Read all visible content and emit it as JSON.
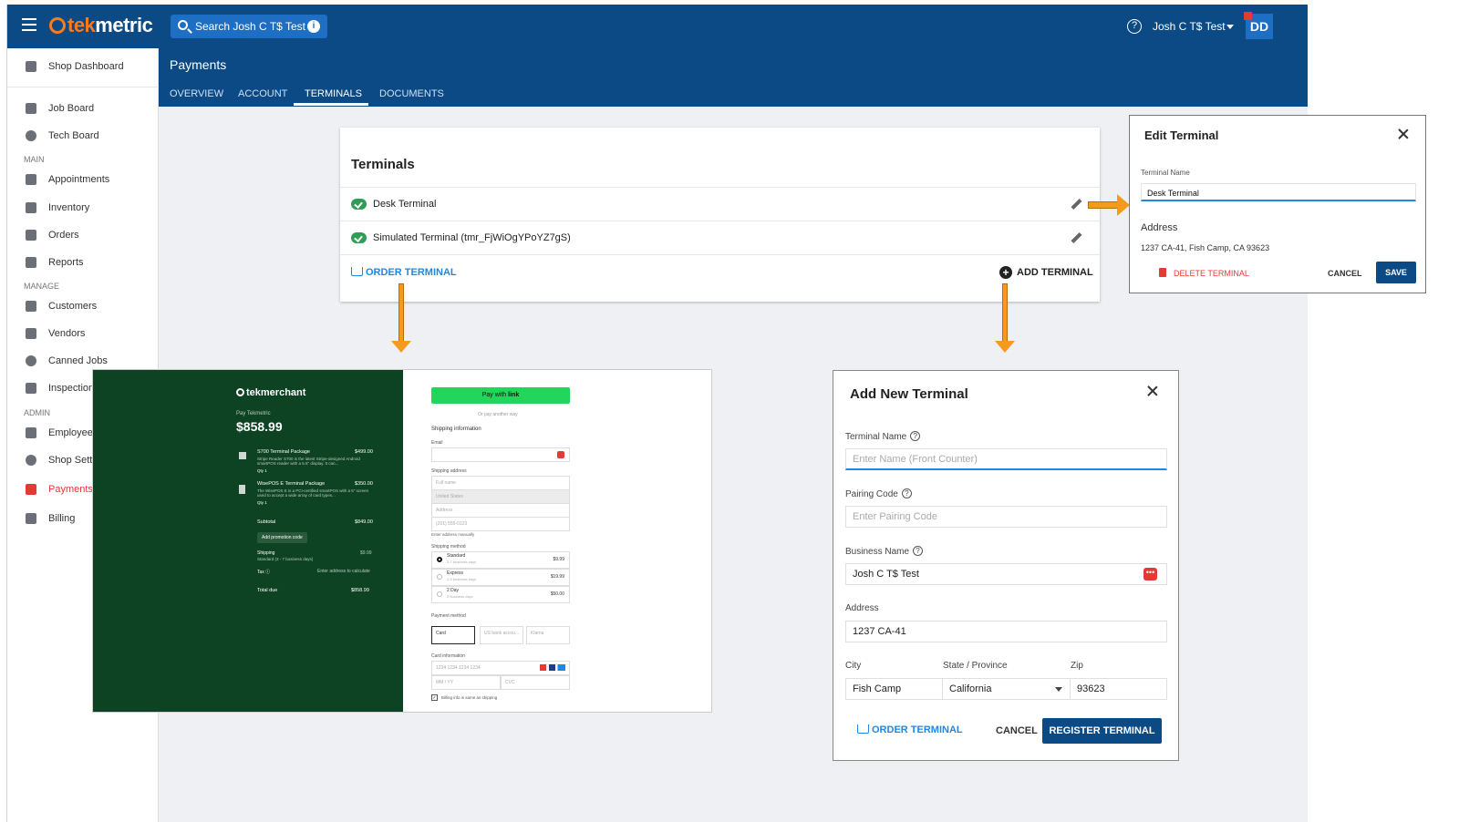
{
  "app": {
    "logo_main": "tek",
    "logo_accent": "metric",
    "search_label": "Search Josh C T$ Test",
    "user_name": "Josh C T$ Test",
    "avatar_initials": "DD",
    "colors": {
      "primary": "#0b4a85",
      "accent": "#ff7a1a",
      "active": "#e53935",
      "link": "#1e88e5"
    }
  },
  "sidebar": {
    "dashboard": "Shop Dashboard",
    "job_board": "Job Board",
    "tech_board": "Tech Board",
    "section_main": "MAIN",
    "appointments": "Appointments",
    "inventory": "Inventory",
    "orders": "Orders",
    "reports": "Reports",
    "section_manage": "MANAGE",
    "customers": "Customers",
    "vendors": "Vendors",
    "canned_jobs": "Canned Jobs",
    "inspections": "Inspection",
    "section_admin": "ADMIN",
    "employees": "Employee",
    "shop_settings": "Shop Setti",
    "payments": "Payments",
    "billing": "Billing"
  },
  "page": {
    "title": "Payments",
    "tabs": {
      "overview": "OVERVIEW",
      "account": "ACCOUNT",
      "terminals": "TERMINALS",
      "documents": "DOCUMENTS"
    }
  },
  "terminals": {
    "title": "Terminals",
    "rows": [
      {
        "name": "Desk Terminal"
      },
      {
        "name": "Simulated Terminal (tmr_FjWiOgYPoYZ7gS)"
      }
    ],
    "order_label": "ORDER TERMINAL",
    "add_label": "ADD TERMINAL"
  },
  "edit_terminal": {
    "title": "Edit Terminal",
    "name_label": "Terminal Name",
    "name_value": "Desk Terminal",
    "address_label": "Address",
    "address_value": "1237 CA-41, Fish Camp, CA 93623",
    "delete_label": "DELETE TERMINAL",
    "cancel_label": "CANCEL",
    "save_label": "SAVE"
  },
  "checkout": {
    "brand": "tekmerchant",
    "pay_label": "Pay Tekmetric",
    "amount": "$858.99",
    "items": [
      {
        "name": "S700 Terminal Package",
        "price": "$499.00",
        "desc": "Stripe Reader S700 is the latest Stripe-designed Android smartPOS reader with a 5.5\" display. It can...",
        "qty": "Qty 1"
      },
      {
        "name": "WisePOS E Terminal Package",
        "price": "$350.00",
        "desc": "The WisePOS E is a PCI-certified smartPOS with a 5\" screen used to accept a wide array of card types...",
        "qty": "Qty 1"
      }
    ],
    "subtotal_label": "Subtotal",
    "subtotal_value": "$849.00",
    "promo_label": "Add promotion code",
    "shipping_label": "Shipping",
    "shipping_sub": "Standard (3 - 7 business days)",
    "shipping_value": "$9.99",
    "tax_label": "Tax ⓘ",
    "tax_value": "Enter address to calculate",
    "total_label": "Total due",
    "total_value": "$858.99",
    "link_btn_prefix": "Pay with",
    "link_btn_brand": "link",
    "or_label": "Or pay another way",
    "shipping_info": "Shipping information",
    "email_label": "Email",
    "ship_addr_label": "Shipping address",
    "full_name": "Full name",
    "country": "United States",
    "address": "Address",
    "phone": "(201) 555-0123",
    "manual": "Enter address manually",
    "method_label": "Shipping method",
    "methods": [
      {
        "name": "Standard",
        "sub": "3-7 business days",
        "price": "$9.99"
      },
      {
        "name": "Express",
        "sub": "2-5 business days",
        "price": "$19.99"
      },
      {
        "name": "2 Day",
        "sub": "2 business days",
        "price": "$50.00"
      }
    ],
    "payment_label": "Payment method",
    "pay_options": [
      "Card",
      "US bank accou...",
      "Klarna"
    ],
    "card_info": "Card information",
    "card_number": "1234 1234 1234 1234",
    "expiry": "MM / YY",
    "cvc": "CVC",
    "billing_same": "Billing info is same as shipping"
  },
  "add_terminal": {
    "title": "Add New Terminal",
    "name_label": "Terminal Name",
    "name_placeholder": "Enter Name (Front Counter)",
    "pairing_label": "Pairing Code",
    "pairing_placeholder": "Enter Pairing Code",
    "business_label": "Business Name",
    "business_value": "Josh C T$ Test",
    "address_label": "Address",
    "address_value": "1237 CA-41",
    "city_label": "City",
    "city_value": "Fish Camp",
    "state_label": "State / Province",
    "state_value": "California",
    "zip_label": "Zip",
    "zip_value": "93623",
    "order_label": "ORDER TERMINAL",
    "cancel_label": "CANCEL",
    "register_label": "REGISTER TERMINAL"
  }
}
